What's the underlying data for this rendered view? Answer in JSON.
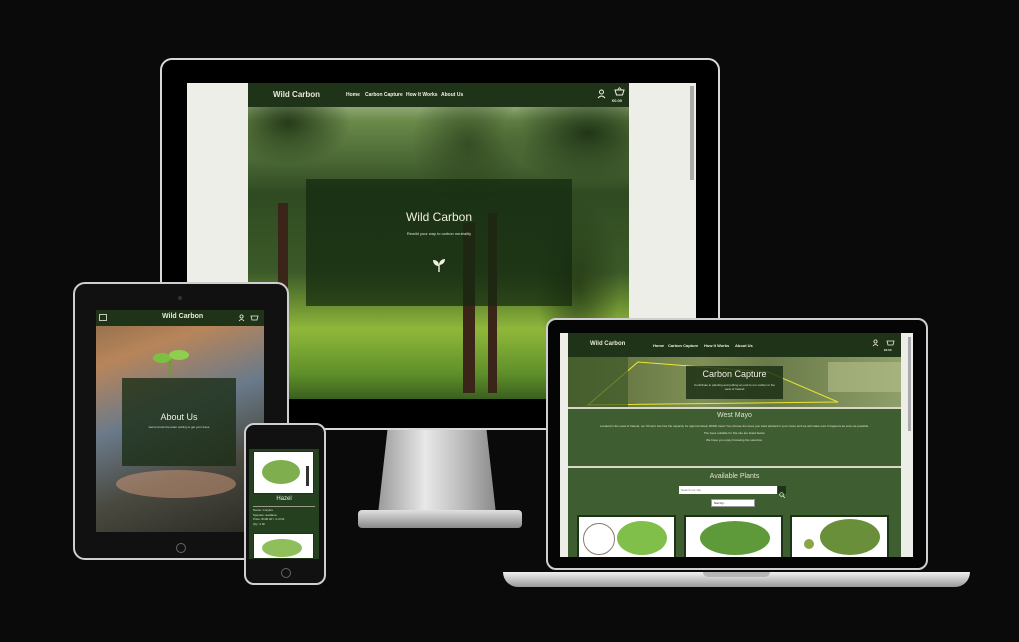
{
  "desktop": {
    "brand": "Wild Carbon",
    "nav": [
      "Home",
      "Carbon Capture",
      "How It Works",
      "About Us"
    ],
    "basket_total": "€0.00",
    "hero_title": "Wild Carbon",
    "hero_subtitle": "Rewild your way to carbon neutrality"
  },
  "tablet": {
    "brand": "Wild Carbon",
    "about_title": "About Us",
    "about_text": "Get to know the team setting to get your trees"
  },
  "phone": {
    "plant_name": "Hazel",
    "details": [
      "Name: Corylus",
      "Species: avellana",
      "Price: €100.00 / m CO2",
      "Qty: 4 bh"
    ]
  },
  "laptop": {
    "brand": "Wild Carbon",
    "nav": [
      "Home",
      "Carbon Capture",
      "How It Works",
      "About Us"
    ],
    "basket_total": "€0.00",
    "banner_title": "Carbon Capture",
    "banner_subtitle": "Contribute to planting and putting an end to our carbon in the west of Ireland",
    "region_title": "West Mayo",
    "region_text": [
      "Located in the west of Ireland, our 30 acre site has the capacity for approximately 30000 trees! You choose the trees you want planted in your name and we will make sure it happens as soon as possible.",
      "The trees suitable for this site are listed below.",
      "We hope you enjoy browsing the selection."
    ],
    "plants_title": "Available Plants",
    "search_placeholder": "Search our site",
    "sort_label": "Sort by..."
  },
  "colors": {
    "background": "#0a0a0a",
    "nav_green": "#1f3318",
    "section_green": "#3e5e32",
    "text_light": "#f0f0e0"
  }
}
